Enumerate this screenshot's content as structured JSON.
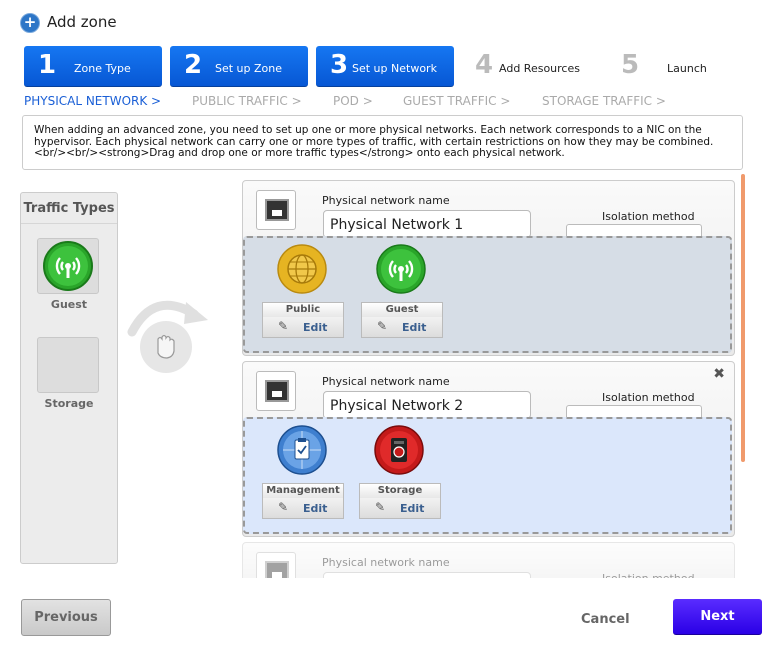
{
  "header": {
    "title": "Add zone",
    "icon": "plus-circle-icon"
  },
  "steps": [
    {
      "num": "1",
      "label": "Zone Type",
      "active": true
    },
    {
      "num": "2",
      "label": "Set up Zone",
      "active": true
    },
    {
      "num": "3",
      "label": "Set up Network",
      "active": true
    },
    {
      "num": "4",
      "label": "Add Resources",
      "active": false
    },
    {
      "num": "5",
      "label": "Launch",
      "active": false
    }
  ],
  "subtabs": [
    {
      "label": "PHYSICAL NETWORK >",
      "active": true
    },
    {
      "label": "PUBLIC TRAFFIC >",
      "active": false
    },
    {
      "label": "POD >",
      "active": false
    },
    {
      "label": "GUEST TRAFFIC >",
      "active": false
    },
    {
      "label": "STORAGE TRAFFIC >",
      "active": false
    }
  ],
  "description": "When adding an advanced zone, you need to set up one or more physical networks. Each network corresponds to a NIC on the hypervisor. Each physical network can carry one or more types of traffic, with certain restrictions on how they may be combined.<br/><br/><strong>Drag and drop one or more traffic types</strong> onto each physical network.",
  "traffic_types": {
    "title": "Traffic Types",
    "items": [
      {
        "label": "Guest",
        "icon": "guest-traffic-icon"
      },
      {
        "label": "Storage",
        "icon": "storage-traffic-placeholder"
      }
    ]
  },
  "networks": [
    {
      "name_label": "Physical network name",
      "name_value": "Physical Network 1",
      "isolation_label": "Isolation method",
      "traffic": [
        {
          "name": "Public",
          "edit": "Edit",
          "icon": "public-globe-icon"
        },
        {
          "name": "Guest",
          "edit": "Edit",
          "icon": "guest-wifi-icon"
        }
      ]
    },
    {
      "name_label": "Physical network name",
      "name_value": "Physical Network 2",
      "isolation_label": "Isolation method",
      "traffic": [
        {
          "name": "Management",
          "edit": "Edit",
          "icon": "management-clipboard-icon"
        },
        {
          "name": "Storage",
          "edit": "Edit",
          "icon": "storage-device-icon"
        }
      ]
    },
    {
      "name_label": "Physical network name",
      "isolation_label": "Isolation method"
    }
  ],
  "buttons": {
    "previous": "Previous",
    "cancel": "Cancel",
    "next": "Next"
  },
  "colors": {
    "step_active": "#0a63e6",
    "subtab_active": "#1a5fd6",
    "next_button": "#3a10f5",
    "scrollbar": "#f09a6c"
  }
}
